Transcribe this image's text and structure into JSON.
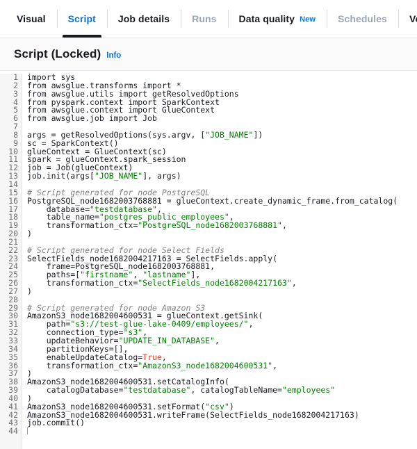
{
  "tabs": [
    {
      "label": "Visual",
      "state": "normal",
      "badge": null
    },
    {
      "label": "Script",
      "state": "active",
      "badge": null
    },
    {
      "label": "Job details",
      "state": "normal",
      "badge": null
    },
    {
      "label": "Runs",
      "state": "disabled",
      "badge": null
    },
    {
      "label": "Data quality",
      "state": "normal",
      "badge": "New"
    },
    {
      "label": "Schedules",
      "state": "disabled",
      "badge": null
    },
    {
      "label": "Versi",
      "state": "normal",
      "badge": null
    }
  ],
  "section": {
    "title": "Script (Locked)",
    "info_label": "Info"
  },
  "colors": {
    "accent": "#0972d3",
    "active_underline": "#16191f",
    "disabled_text": "#9ba7b6",
    "comment": "#808080",
    "string": "#008000",
    "boolean": "#d44125",
    "gutter_bg": "#f6f6f6",
    "header_bg": "#fafafa"
  },
  "editor": {
    "first_line": 1,
    "last_line": 44,
    "language": "python",
    "lines": [
      {
        "n": 1,
        "tokens": [
          {
            "t": "import sys",
            "c": "kw"
          }
        ]
      },
      {
        "n": 2,
        "tokens": [
          {
            "t": "from awsglue.transforms import *",
            "c": "kw"
          }
        ]
      },
      {
        "n": 3,
        "tokens": [
          {
            "t": "from awsglue.utils import getResolvedOptions",
            "c": "kw"
          }
        ]
      },
      {
        "n": 4,
        "tokens": [
          {
            "t": "from pyspark.context import SparkContext",
            "c": "kw"
          }
        ]
      },
      {
        "n": 5,
        "tokens": [
          {
            "t": "from awsglue.context import GlueContext",
            "c": "kw"
          }
        ]
      },
      {
        "n": 6,
        "tokens": [
          {
            "t": "from awsglue.job import Job",
            "c": "kw"
          }
        ]
      },
      {
        "n": 7,
        "tokens": []
      },
      {
        "n": 8,
        "tokens": [
          {
            "t": "args = getResolvedOptions(sys.argv, [",
            "c": "kw"
          },
          {
            "t": "\"JOB_NAME\"",
            "c": "str"
          },
          {
            "t": "])",
            "c": "kw"
          }
        ]
      },
      {
        "n": 9,
        "tokens": [
          {
            "t": "sc = SparkContext()",
            "c": "kw"
          }
        ]
      },
      {
        "n": 10,
        "tokens": [
          {
            "t": "glueContext = GlueContext(sc)",
            "c": "kw"
          }
        ]
      },
      {
        "n": 11,
        "tokens": [
          {
            "t": "spark = glueContext.spark_session",
            "c": "kw"
          }
        ]
      },
      {
        "n": 12,
        "tokens": [
          {
            "t": "job = Job(glueContext)",
            "c": "kw"
          }
        ]
      },
      {
        "n": 13,
        "tokens": [
          {
            "t": "job.init(args[",
            "c": "kw"
          },
          {
            "t": "\"JOB_NAME\"",
            "c": "str"
          },
          {
            "t": "], args)",
            "c": "kw"
          }
        ]
      },
      {
        "n": 14,
        "tokens": []
      },
      {
        "n": 15,
        "tokens": [
          {
            "t": "# Script generated for node PostgreSQL",
            "c": "com"
          }
        ]
      },
      {
        "n": 16,
        "tokens": [
          {
            "t": "PostgreSQL_node1682003768881 = glueContext.create_dynamic_frame.from_catalog(",
            "c": "kw"
          }
        ]
      },
      {
        "n": 17,
        "tokens": [
          {
            "t": "    database=",
            "c": "kw"
          },
          {
            "t": "\"testdatabase\"",
            "c": "str"
          },
          {
            "t": ",",
            "c": "kw"
          }
        ]
      },
      {
        "n": 18,
        "tokens": [
          {
            "t": "    table_name=",
            "c": "kw"
          },
          {
            "t": "\"postgres_public_employees\"",
            "c": "str"
          },
          {
            "t": ",",
            "c": "kw"
          }
        ]
      },
      {
        "n": 19,
        "tokens": [
          {
            "t": "    transformation_ctx=",
            "c": "kw"
          },
          {
            "t": "\"PostgreSQL_node1682003768881\"",
            "c": "str"
          },
          {
            "t": ",",
            "c": "kw"
          }
        ]
      },
      {
        "n": 20,
        "tokens": [
          {
            "t": ")",
            "c": "kw"
          }
        ]
      },
      {
        "n": 21,
        "tokens": []
      },
      {
        "n": 22,
        "tokens": [
          {
            "t": "# Script generated for node Select Fields",
            "c": "com"
          }
        ]
      },
      {
        "n": 23,
        "tokens": [
          {
            "t": "SelectFields_node1682004217163 = SelectFields.apply(",
            "c": "kw"
          }
        ]
      },
      {
        "n": 24,
        "tokens": [
          {
            "t": "    frame=PostgreSQL_node1682003768881,",
            "c": "kw"
          }
        ]
      },
      {
        "n": 25,
        "tokens": [
          {
            "t": "    paths=[",
            "c": "kw"
          },
          {
            "t": "\"firstname\"",
            "c": "str"
          },
          {
            "t": ", ",
            "c": "kw"
          },
          {
            "t": "\"lastname\"",
            "c": "str"
          },
          {
            "t": "],",
            "c": "kw"
          }
        ]
      },
      {
        "n": 26,
        "tokens": [
          {
            "t": "    transformation_ctx=",
            "c": "kw"
          },
          {
            "t": "\"SelectFields_node1682004217163\"",
            "c": "str"
          },
          {
            "t": ",",
            "c": "kw"
          }
        ]
      },
      {
        "n": 27,
        "tokens": [
          {
            "t": ")",
            "c": "kw"
          }
        ]
      },
      {
        "n": 28,
        "tokens": []
      },
      {
        "n": 29,
        "tokens": [
          {
            "t": "# Script generated for node Amazon S3",
            "c": "com"
          }
        ]
      },
      {
        "n": 30,
        "tokens": [
          {
            "t": "AmazonS3_node1682004600531 = glueContext.getSink(",
            "c": "kw"
          }
        ]
      },
      {
        "n": 31,
        "tokens": [
          {
            "t": "    path=",
            "c": "kw"
          },
          {
            "t": "\"s3://test-glue-lake-0409/employees/\"",
            "c": "str"
          },
          {
            "t": ",",
            "c": "kw"
          }
        ]
      },
      {
        "n": 32,
        "tokens": [
          {
            "t": "    connection_type=",
            "c": "kw"
          },
          {
            "t": "\"s3\"",
            "c": "str"
          },
          {
            "t": ",",
            "c": "kw"
          }
        ]
      },
      {
        "n": 33,
        "tokens": [
          {
            "t": "    updateBehavior=",
            "c": "kw"
          },
          {
            "t": "\"UPDATE_IN_DATABASE\"",
            "c": "str"
          },
          {
            "t": ",",
            "c": "kw"
          }
        ]
      },
      {
        "n": 34,
        "tokens": [
          {
            "t": "    partitionKeys=[],",
            "c": "kw"
          }
        ]
      },
      {
        "n": 35,
        "tokens": [
          {
            "t": "    enableUpdateCatalog=",
            "c": "kw"
          },
          {
            "t": "True",
            "c": "bool"
          },
          {
            "t": ",",
            "c": "kw"
          }
        ]
      },
      {
        "n": 36,
        "tokens": [
          {
            "t": "    transformation_ctx=",
            "c": "kw"
          },
          {
            "t": "\"AmazonS3_node1682004600531\"",
            "c": "str"
          },
          {
            "t": ",",
            "c": "kw"
          }
        ]
      },
      {
        "n": 37,
        "tokens": [
          {
            "t": ")",
            "c": "kw"
          }
        ]
      },
      {
        "n": 38,
        "tokens": [
          {
            "t": "AmazonS3_node1682004600531.setCatalogInfo(",
            "c": "kw"
          }
        ]
      },
      {
        "n": 39,
        "tokens": [
          {
            "t": "    catalogDatabase=",
            "c": "kw"
          },
          {
            "t": "\"testdatabase\"",
            "c": "str"
          },
          {
            "t": ", catalogTableName=",
            "c": "kw"
          },
          {
            "t": "\"employees\"",
            "c": "str"
          }
        ]
      },
      {
        "n": 40,
        "tokens": [
          {
            "t": ")",
            "c": "kw"
          }
        ]
      },
      {
        "n": 41,
        "tokens": [
          {
            "t": "AmazonS3_node1682004600531.setFormat(",
            "c": "kw"
          },
          {
            "t": "\"csv\"",
            "c": "str"
          },
          {
            "t": ")",
            "c": "kw"
          }
        ]
      },
      {
        "n": 42,
        "tokens": [
          {
            "t": "AmazonS3_node1682004600531.writeFrame(SelectFields_node1682004217163)",
            "c": "kw"
          }
        ]
      },
      {
        "n": 43,
        "tokens": [
          {
            "t": "job.commit()",
            "c": "kw"
          }
        ]
      },
      {
        "n": 44,
        "tokens": [],
        "caret": true
      }
    ]
  }
}
